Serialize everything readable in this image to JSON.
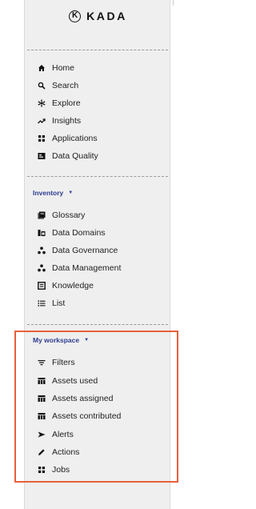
{
  "brand": {
    "name": "KADA",
    "logo_letter": "K"
  },
  "main_nav": [
    {
      "label": "Home",
      "icon": "home-icon"
    },
    {
      "label": "Search",
      "icon": "search-icon"
    },
    {
      "label": "Explore",
      "icon": "explore-icon"
    },
    {
      "label": "Insights",
      "icon": "insights-icon"
    },
    {
      "label": "Applications",
      "icon": "applications-icon"
    },
    {
      "label": "Data Quality",
      "icon": "data-quality-icon"
    }
  ],
  "inventory": {
    "title": "Inventory",
    "items": [
      {
        "label": "Glossary",
        "icon": "glossary-icon"
      },
      {
        "label": "Data Domains",
        "icon": "data-domains-icon"
      },
      {
        "label": "Data Governance",
        "icon": "data-governance-icon"
      },
      {
        "label": "Data Management",
        "icon": "data-management-icon"
      },
      {
        "label": "Knowledge",
        "icon": "knowledge-icon"
      },
      {
        "label": "List",
        "icon": "list-icon"
      }
    ]
  },
  "workspace": {
    "title": "My workspace",
    "items": [
      {
        "label": "Filters",
        "icon": "filter-icon"
      },
      {
        "label": "Assets used",
        "icon": "table-icon"
      },
      {
        "label": "Assets assigned",
        "icon": "table-icon"
      },
      {
        "label": "Assets contributed",
        "icon": "table-icon"
      },
      {
        "label": "Alerts",
        "icon": "alerts-icon"
      },
      {
        "label": "Actions",
        "icon": "actions-icon"
      },
      {
        "label": "Jobs",
        "icon": "jobs-icon"
      }
    ]
  },
  "colors": {
    "sidebar_bg": "#efefef",
    "section_title": "#2f3d8f",
    "highlight_border": "#e8603a",
    "text": "#222222"
  }
}
